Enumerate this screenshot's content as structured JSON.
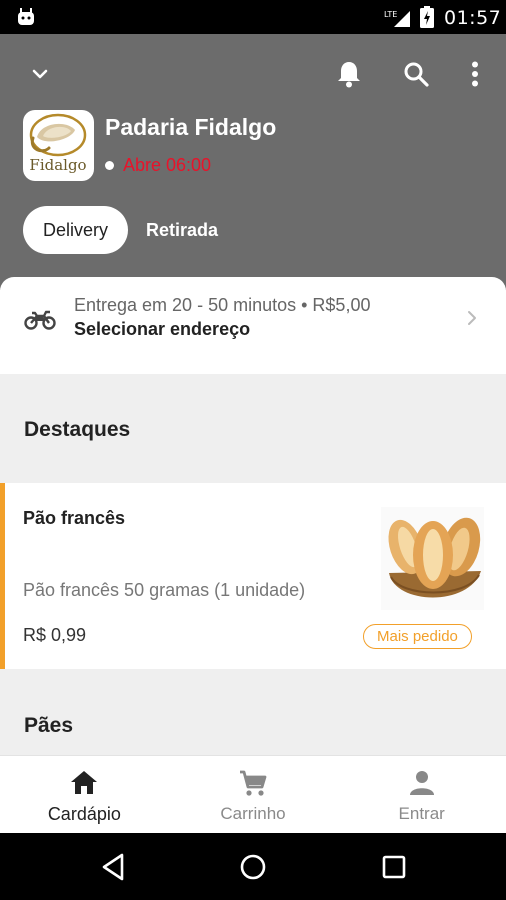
{
  "status_bar": {
    "time": "01:57",
    "network": "LTE"
  },
  "header": {
    "store_name": "Padaria Fidalgo",
    "status": "Abre 06:00",
    "logo_text": "Fidalgo",
    "modes": [
      "Delivery",
      "Retirada"
    ],
    "active_mode": "Delivery"
  },
  "delivery": {
    "info": "Entrega em 20 - 50 minutos • R$5,00",
    "address_label": "Selecionar endereço"
  },
  "sections": {
    "highlights": "Destaques",
    "breads": "Pães"
  },
  "product": {
    "name": "Pão francês",
    "description": "Pão francês 50 gramas (1 unidade)",
    "price": "R$ 0,99",
    "badge": "Mais pedido"
  },
  "bottom_nav": [
    {
      "label": "Cardápio",
      "icon": "home-icon",
      "active": true
    },
    {
      "label": "Carrinho",
      "icon": "cart-icon",
      "active": false
    },
    {
      "label": "Entrar",
      "icon": "person-icon",
      "active": false
    }
  ],
  "colors": {
    "accent": "#f2a02a",
    "closed_status": "#e8132a",
    "header_bg": "#6c6c6c"
  }
}
